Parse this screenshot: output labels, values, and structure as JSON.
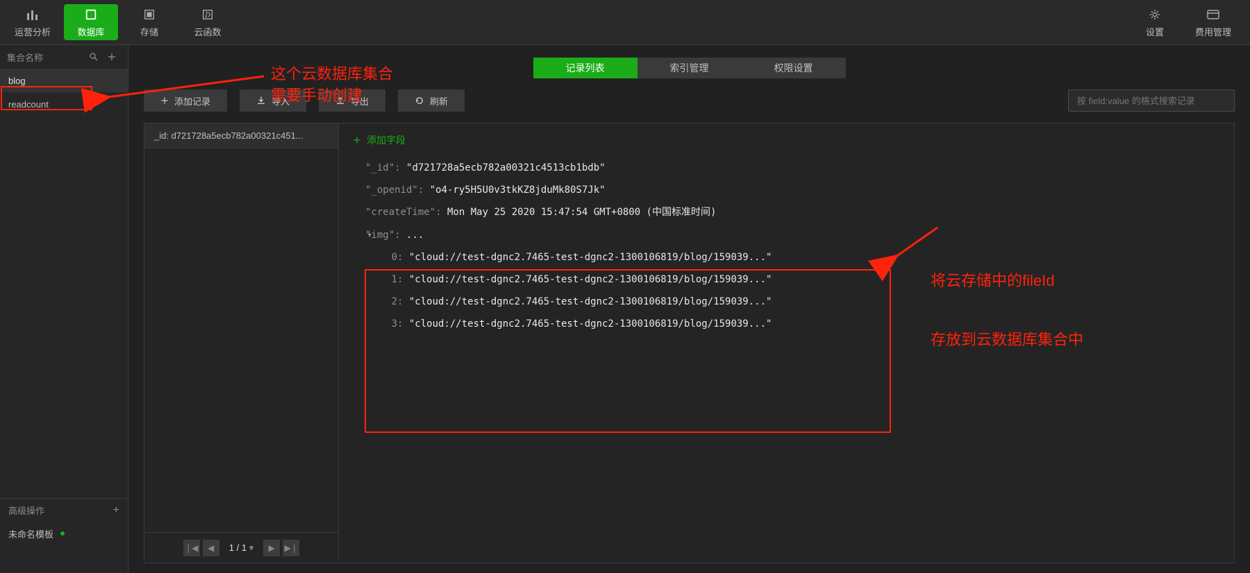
{
  "nav": {
    "analytics": "运营分析",
    "database": "数据库",
    "storage": "存储",
    "functions": "云函数",
    "settings": "设置",
    "billing": "费用管理"
  },
  "sidebar": {
    "title": "集合名称",
    "items": [
      "blog",
      "readcount"
    ],
    "advanced": "高级操作",
    "template": "未命名模板"
  },
  "tabs": {
    "records": "记录列表",
    "indexes": "索引管理",
    "permissions": "权限设置"
  },
  "toolbar": {
    "add": "添加记录",
    "import": "导入",
    "export": "导出",
    "refresh": "刷新",
    "search_placeholder": "按 field:value 的格式搜索记录"
  },
  "add_field": "添加字段",
  "record_id_label": "_id: d721728a5ecb782a00321c451...",
  "pager": "1 / 1",
  "doc": {
    "_id_key": "\"_id\"",
    "_id_val": "\"d721728a5ecb782a00321c4513cb1bdb\"",
    "openid_key": "\"_openid\"",
    "openid_val": "\"o4-ry5H5U0v3tkKZ8jduMk80S7Jk\"",
    "ctime_key": "\"createTime\"",
    "ctime_val": "Mon May 25 2020 15:47:54 GMT+0800 (中国标准时间)",
    "img_key": "\"img\"",
    "img_ell": "...",
    "img": [
      "\"cloud://test-dgnc2.7465-test-dgnc2-1300106819/blog/159039...\"",
      "\"cloud://test-dgnc2.7465-test-dgnc2-1300106819/blog/159039...\"",
      "\"cloud://test-dgnc2.7465-test-dgnc2-1300106819/blog/159039...\"",
      "\"cloud://test-dgnc2.7465-test-dgnc2-1300106819/blog/159039...\""
    ]
  },
  "annotations": {
    "top": "这个云数据库集合\n需要手动创建",
    "r1": "将云存储中的fileId",
    "r2": "存放到云数据库集合中"
  }
}
